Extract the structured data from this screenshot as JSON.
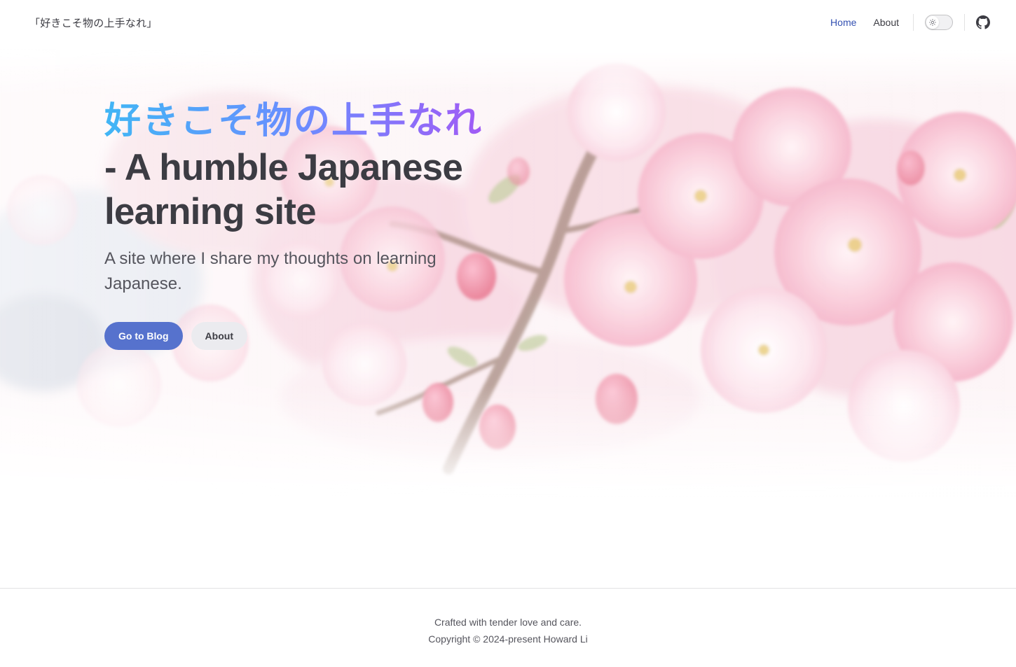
{
  "nav": {
    "site_title": "「好きこそ物の上手なれ」",
    "links": [
      {
        "label": "Home",
        "active": true
      },
      {
        "label": "About",
        "active": false
      }
    ],
    "theme_toggle_icon": "sun-icon",
    "github_icon": "github-icon"
  },
  "hero": {
    "name": "好きこそ物の上手なれ",
    "text": "- A humble Japanese learning site",
    "tagline": "A site where I share my thoughts on learning Japanese.",
    "actions": [
      {
        "label": "Go to Blog",
        "theme": "brand"
      },
      {
        "label": "About",
        "theme": "alt"
      }
    ],
    "background": "cherry-blossom-image"
  },
  "footer": {
    "message": "Crafted with tender love and care.",
    "copyright": "Copyright © 2024-present Howard Li"
  },
  "colors": {
    "brand": "#5672cd",
    "active_link": "#3451b2",
    "name_gradient": [
      "#41b6f5",
      "#6b8cff",
      "#b14cf2"
    ],
    "blossom": "#f7c6d6"
  }
}
